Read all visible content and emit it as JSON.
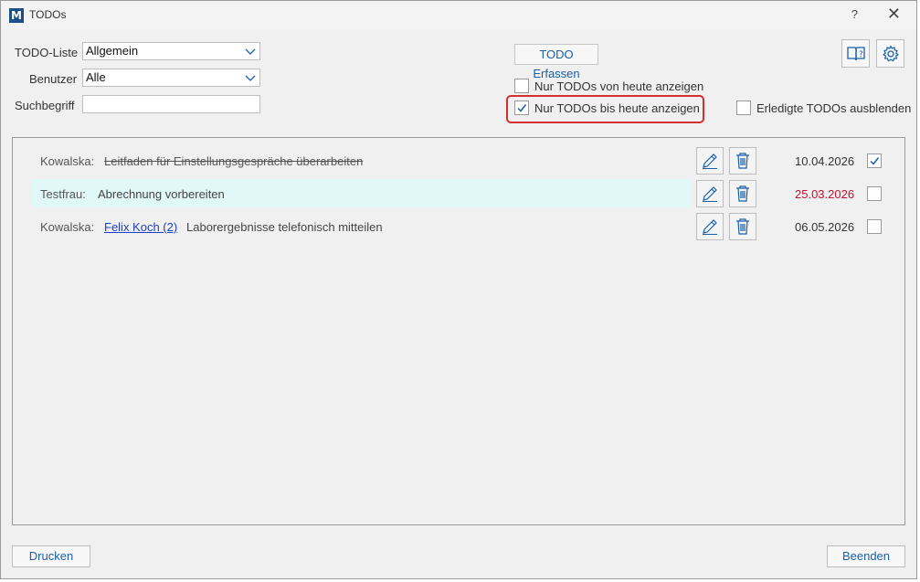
{
  "window": {
    "title": "TODOs",
    "logo_letter": "M",
    "help_label": "?",
    "close_label": "✕"
  },
  "filters": {
    "todo_list_label": "TODO-Liste",
    "todo_list_value": "Allgemein",
    "user_label": "Benutzer",
    "user_value": "Alle",
    "search_label": "Suchbegriff",
    "search_value": ""
  },
  "actions": {
    "erfassen_label": "TODO Erfassen",
    "help_icon": "book-help-icon",
    "settings_icon": "gear-icon"
  },
  "options": {
    "only_today_label": "Nur TODOs von heute anzeigen",
    "only_today_checked": false,
    "until_today_label": "Nur TODOs bis heute anzeigen",
    "until_today_checked": true,
    "hide_done_label": "Erledigte TODOs ausblenden",
    "hide_done_checked": false
  },
  "todos": [
    {
      "user": "Kowalska:",
      "link": "",
      "text": "Leitfaden für Einstellungsgespräche überarbeiten",
      "date": "10.04.2026",
      "done": true,
      "overdue": false,
      "highlighted": false
    },
    {
      "user": "Testfrau:",
      "link": "",
      "text": "Abrechnung vorbereiten",
      "date": "25.03.2026",
      "done": false,
      "overdue": true,
      "highlighted": true
    },
    {
      "user": "Kowalska:",
      "link": "Felix Koch (2)",
      "text": "Laborergebnisse telefonisch mitteilen",
      "date": "06.05.2026",
      "done": false,
      "overdue": false,
      "highlighted": false
    }
  ],
  "footer": {
    "print_label": "Drucken",
    "close_label": "Beenden"
  },
  "colors": {
    "accent": "#1a5fa8",
    "overdue": "#c8102e",
    "highlight_row": "#e0f8f8",
    "callout": "#d32f2f"
  }
}
